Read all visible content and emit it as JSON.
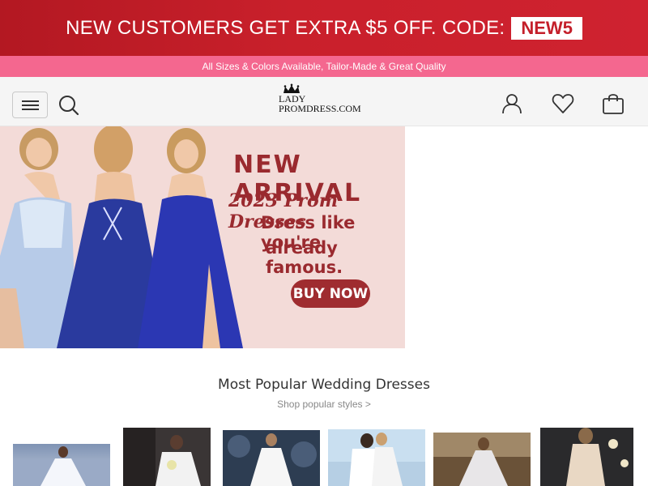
{
  "promo": {
    "text": "NEW CUSTOMERS GET EXTRA $5 OFF. CODE:",
    "code": "NEW5",
    "color": "#c41f2a"
  },
  "subbar": {
    "text": "All Sizes & Colors Available, Tailor-Made & Great Quality",
    "color": "#f4678f"
  },
  "header": {
    "logo_line1": "LADY",
    "logo_line2": "PROMDRESS.COM",
    "icons": [
      "menu-icon",
      "search-icon",
      "account-icon",
      "heart-icon",
      "bag-icon"
    ]
  },
  "banner": {
    "headline": "NEW ARRIVAL",
    "subline": "2023 Prom Dresses",
    "tagline1": "Dress like you're",
    "tagline2": "already famous.",
    "cta": "BUY NOW",
    "accent": "#9a2a2f"
  },
  "section": {
    "title": "Most Popular Wedding Dresses",
    "subtitle": "Shop popular styles >"
  }
}
